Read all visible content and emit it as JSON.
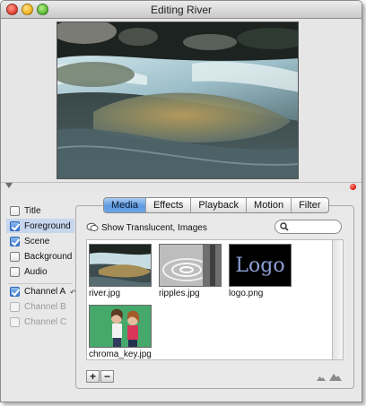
{
  "window": {
    "title": "Editing River"
  },
  "layers": [
    {
      "label": "Title",
      "checked": false,
      "selected": false,
      "disabled": false
    },
    {
      "label": "Foreground",
      "checked": true,
      "selected": true,
      "disabled": false
    },
    {
      "label": "Scene",
      "checked": true,
      "selected": false,
      "disabled": false
    },
    {
      "label": "Background",
      "checked": false,
      "selected": false,
      "disabled": false
    },
    {
      "label": "Audio",
      "checked": false,
      "selected": false,
      "disabled": false
    }
  ],
  "channels": [
    {
      "label": "Channel A",
      "checked": true,
      "disabled": false
    },
    {
      "label": "Channel B",
      "checked": false,
      "disabled": true
    },
    {
      "label": "Channel C",
      "checked": false,
      "disabled": true
    }
  ],
  "tabs": [
    {
      "label": "Media",
      "active": true
    },
    {
      "label": "Effects",
      "active": false
    },
    {
      "label": "Playback",
      "active": false
    },
    {
      "label": "Motion",
      "active": false
    },
    {
      "label": "Filter",
      "active": false
    }
  ],
  "media": {
    "filter_label": "Show Translucent, Images",
    "search_value": "",
    "files": [
      {
        "name": "river.jpg",
        "icon": "river-thumbnail"
      },
      {
        "name": "ripples.jpg",
        "icon": "ripples-thumbnail"
      },
      {
        "name": "logo.png",
        "icon": "logo-thumbnail",
        "logo_text": "Logo"
      },
      {
        "name": "chroma_key.jpg",
        "icon": "chroma-key-thumbnail"
      }
    ]
  },
  "icons": {
    "add": "+",
    "remove": "−",
    "zoom_small": "mountain-small-icon",
    "zoom_large": "mountain-large-icon"
  },
  "colors": {
    "selection": "#c7d6ee",
    "tab_active": "#5f9be2",
    "alert_dot": "#d81c10"
  }
}
